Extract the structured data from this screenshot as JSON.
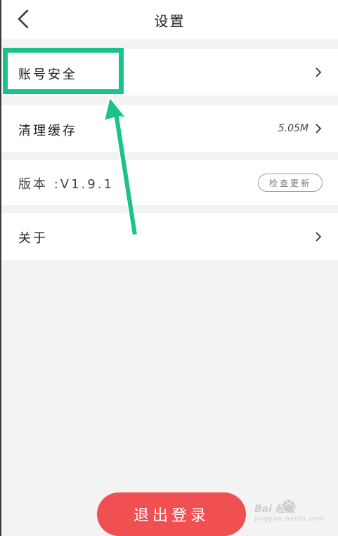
{
  "header": {
    "title": "设置"
  },
  "settings": {
    "account_security": "账号安全",
    "clear_cache": "清理缓存",
    "cache_size": "5.05M",
    "version_label": "版本 :V1.9.1",
    "check_update": "检查更新",
    "about": "关于"
  },
  "logout": {
    "label": "退出登录"
  },
  "watermark": {
    "brand": "Bai 经验",
    "sub": "jingyan.baidu.com"
  },
  "colors": {
    "accent_green": "#1bc38a",
    "logout_red": "#f15053",
    "background": "#f3f3f3"
  }
}
